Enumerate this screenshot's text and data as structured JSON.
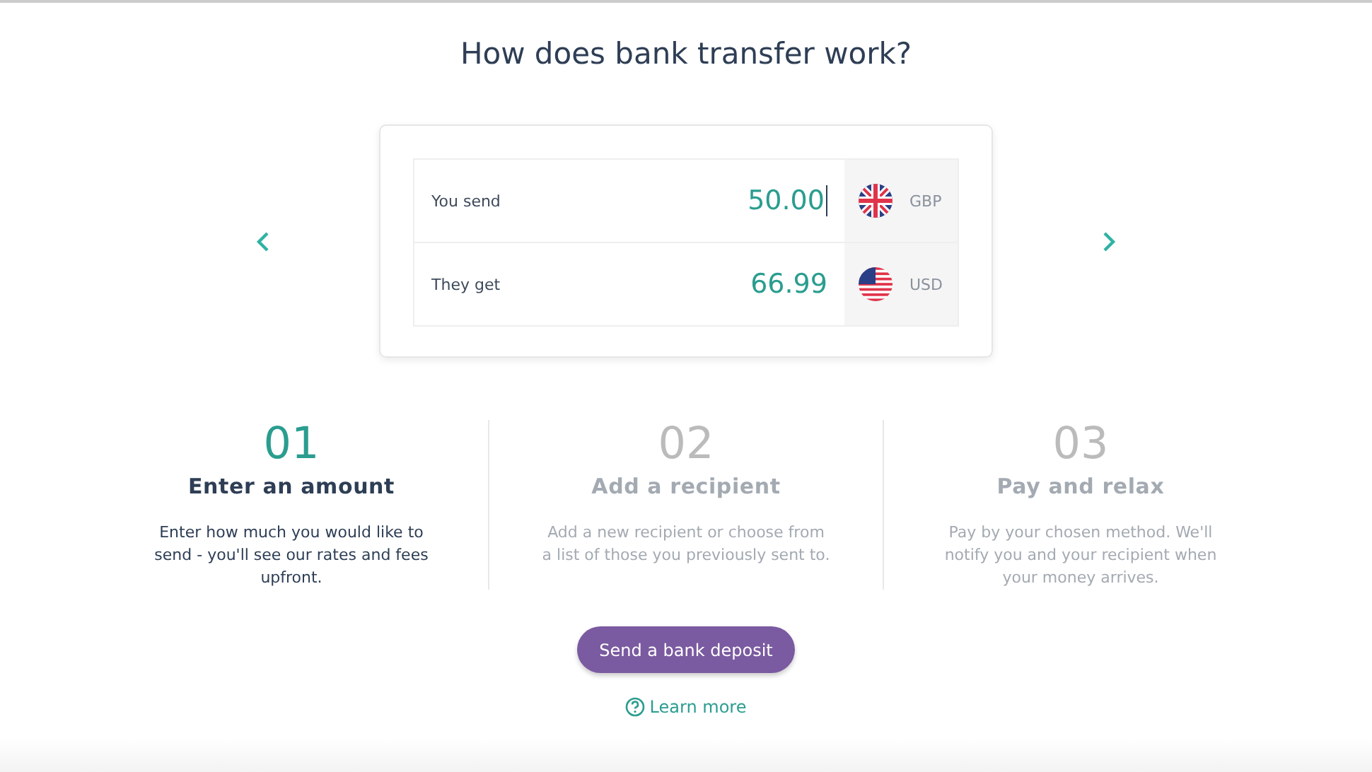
{
  "title": "How does bank transfer work?",
  "converter": {
    "rows": [
      {
        "label": "You send",
        "value": "50.00",
        "currency": "GBP",
        "focused": true
      },
      {
        "label": "They get",
        "value": "66.99",
        "currency": "USD",
        "focused": false
      }
    ]
  },
  "steps": [
    {
      "number": "01",
      "title": "Enter an amount",
      "text": "Enter how much you would like to send - you'll see our rates and fees upfront.",
      "selected": true
    },
    {
      "number": "02",
      "title": "Add a recipient",
      "text": "Add a new recipient or choose from a list of those you previously sent to.",
      "selected": false
    },
    {
      "number": "03",
      "title": "Pay and relax",
      "text": "Pay by your chosen method. We'll notify you and your recipient when your money arrives.",
      "selected": false
    }
  ],
  "button": "Send a bank deposit",
  "link": "Learn more"
}
